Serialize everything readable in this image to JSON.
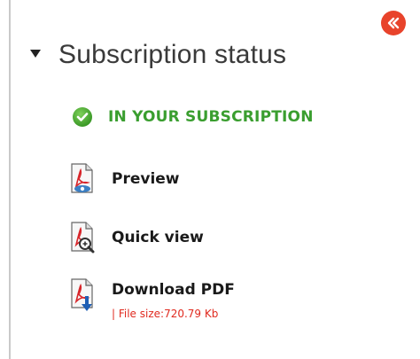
{
  "panel": {
    "title": "Subscription status",
    "collapse_icon": "double-chevron-left-icon",
    "status": {
      "label": "IN YOUR SUBSCRIPTION",
      "icon": "check-circle-icon",
      "color": "#3a9e2f"
    },
    "actions": [
      {
        "label": "Preview",
        "icon": "pdf-preview-icon"
      },
      {
        "label": "Quick view",
        "icon": "pdf-quick-view-icon"
      },
      {
        "label": "Download PDF",
        "icon": "pdf-download-icon"
      }
    ],
    "file_size": "| File size:720.79 Kb"
  },
  "colors": {
    "accent": "#e8432b",
    "status_green": "#3a9e2f",
    "file_size_red": "#e02a1f"
  }
}
